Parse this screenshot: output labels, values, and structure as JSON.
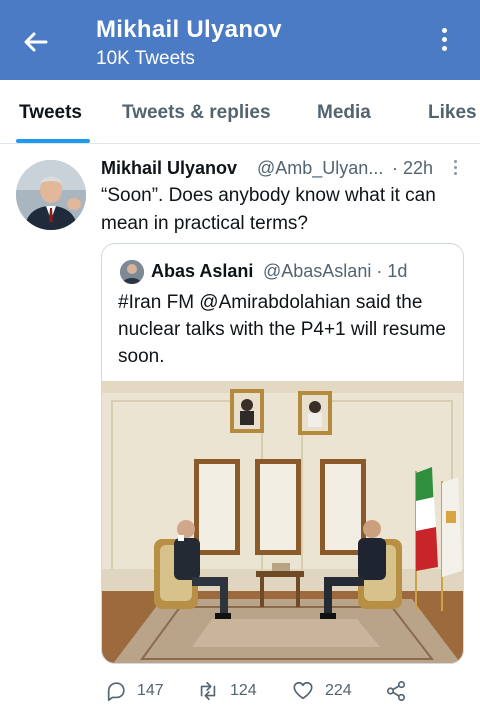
{
  "header": {
    "title": "Mikhail Ulyanov",
    "subtitle": "10K Tweets",
    "color": "#4a7bc4"
  },
  "tabs": [
    {
      "label": "Tweets",
      "active": true
    },
    {
      "label": "Tweets & replies",
      "active": false
    },
    {
      "label": "Media",
      "active": false
    },
    {
      "label": "Likes",
      "active": false
    }
  ],
  "tweet": {
    "name": "Mikhail Ulyanov",
    "handle": "@Amb_Ulyan...",
    "time": "· 22h",
    "text": "“Soon”. Does anybody know what it can mean in practical terms?",
    "quote": {
      "name": "Abas Aslani",
      "handle": "@AbasAslani · 1d",
      "text": "#Iran FM @Amirabdolahian said the nuclear talks with the P4+1 will resume soon."
    },
    "actions": {
      "replies": "147",
      "retweets": "124",
      "likes": "224"
    }
  },
  "icons": [
    "back-arrow-icon",
    "more-vertical-icon",
    "reply-icon",
    "retweet-icon",
    "like-icon",
    "share-icon"
  ],
  "accent_color": "#1d9bf0"
}
